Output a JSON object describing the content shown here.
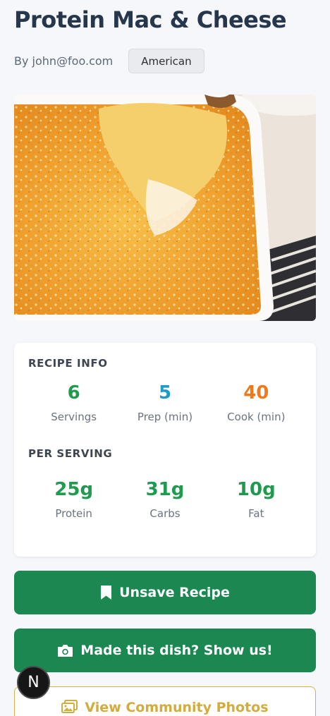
{
  "recipe": {
    "title": "Protein Mac & Cheese",
    "author": "By john@foo.com",
    "cuisine_tag": "American"
  },
  "hero_image": {
    "alt": "Protein Mac & Cheese"
  },
  "recipe_info": {
    "label": "RECIPE INFO",
    "stats": [
      {
        "value": "6",
        "label": "Servings",
        "color": "#1f9a4f"
      },
      {
        "value": "5",
        "label": "Prep (min)",
        "color": "#1c9cc4"
      },
      {
        "value": "40",
        "label": "Cook (min)",
        "color": "#f07a1a"
      }
    ]
  },
  "per_serving": {
    "label": "PER SERVING",
    "stats": [
      {
        "value": "25g",
        "label": "Protein",
        "color": "#1f9a4f"
      },
      {
        "value": "31g",
        "label": "Carbs",
        "color": "#1f9a4f"
      },
      {
        "value": "10g",
        "label": "Fat",
        "color": "#1f9a4f"
      }
    ]
  },
  "actions": {
    "unsave_label": "Unsave Recipe",
    "made_label": "Made this dish? Show us!",
    "community_label": "View Community Photos"
  },
  "fab": {
    "letter": "N"
  },
  "colors": {
    "primary": "#1b8751",
    "outline_accent": "#d4b14a"
  }
}
